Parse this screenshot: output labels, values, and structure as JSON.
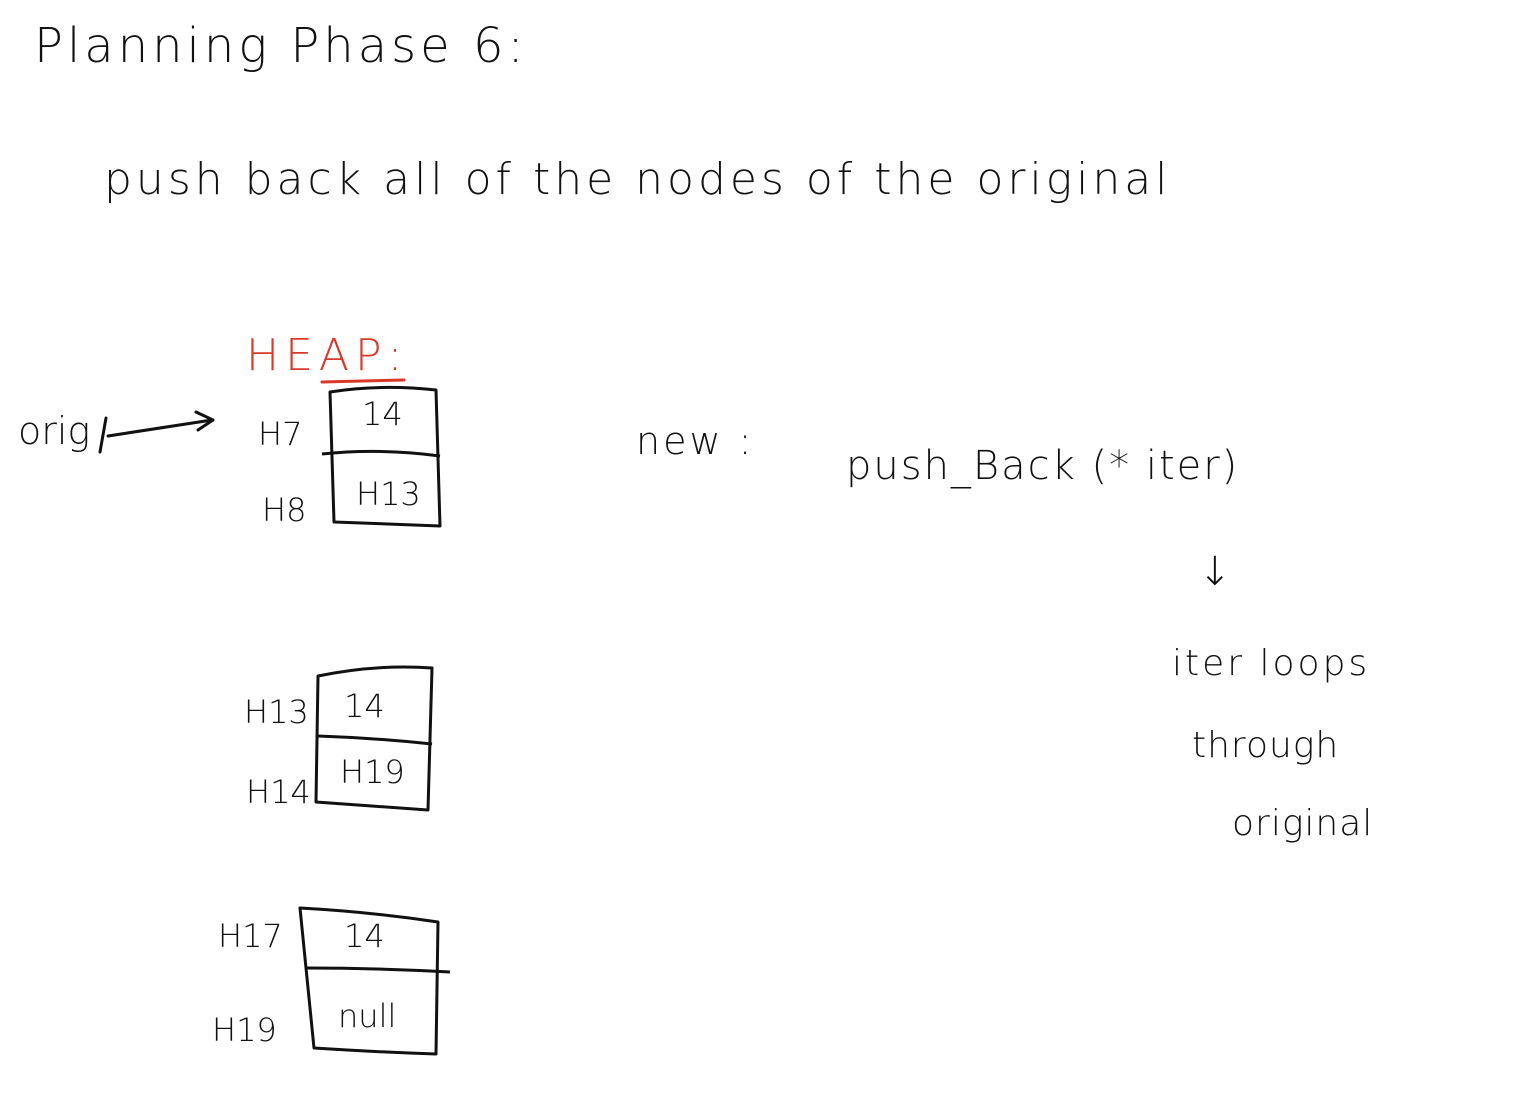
{
  "title": "Planning Phase 6:",
  "subtitle": "push back all of the nodes of the original",
  "heap_label": "HEAP:",
  "pointer_label": "orig",
  "new_label": "new :",
  "call": "push_Back (* iter)",
  "down_arrow": "↓",
  "notes": [
    "iter loops",
    "through",
    "original"
  ],
  "nodes": [
    {
      "addr_top": "H7",
      "addr_bottom": "H8",
      "value": "14",
      "next": "H13"
    },
    {
      "addr_top": "H13",
      "addr_bottom": "H14",
      "value": "14",
      "next": "H19"
    },
    {
      "addr_top": "H17",
      "addr_bottom": "H19",
      "value": "14",
      "next": "null"
    }
  ],
  "colors": {
    "ink": "#111111",
    "heap": "#d9392b"
  }
}
